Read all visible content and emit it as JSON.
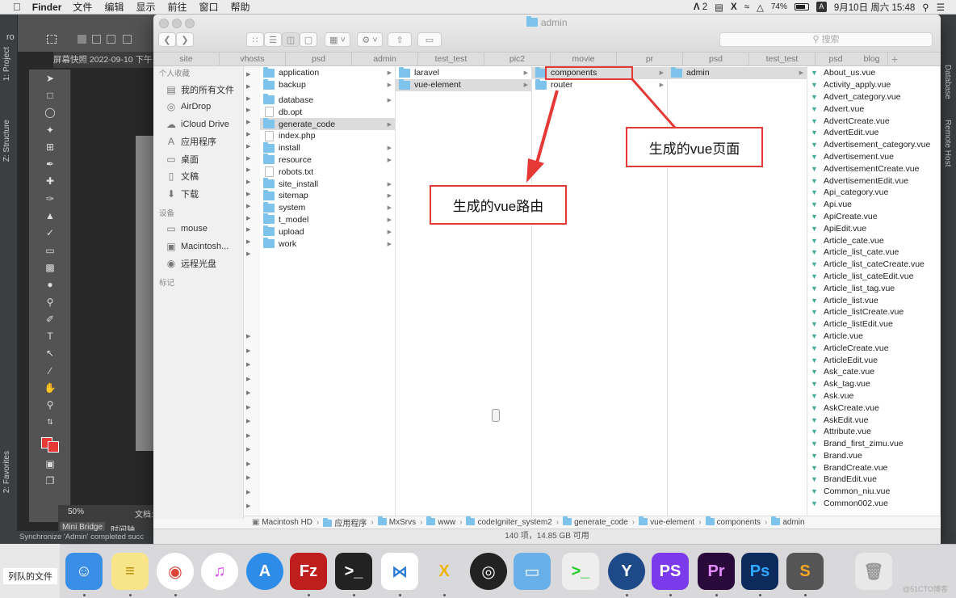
{
  "menubar": {
    "apple": "",
    "app_name": "Finder",
    "menus": [
      "文件",
      "编辑",
      "显示",
      "前往",
      "窗口",
      "帮助"
    ],
    "status": {
      "adobe": "2",
      "battery": "74%",
      "input_method": "A",
      "datetime": "9月10日 周六 15:48"
    }
  },
  "ide": {
    "left_tabs": [
      "1: Project",
      "Z: Structure",
      "2: Favorites"
    ],
    "right_tabs": [
      "Database",
      "Remote Host"
    ],
    "sync_message": "Synchronize 'Admin' completed succ",
    "project_label": "ro"
  },
  "photoshop": {
    "doc_title": "屏幕快照 2022-09-10 下午",
    "zoom": "50%",
    "doc_label": "文档:",
    "bottom_tabs": [
      "Mini Bridge",
      "时间轴"
    ]
  },
  "queued_window": {
    "label": "列队的文件"
  },
  "finder": {
    "window_title": "admin",
    "search_placeholder": "搜索",
    "tabs": [
      "site",
      "vhosts",
      "psd",
      "admin",
      "test_test",
      "pic2",
      "movie",
      "pr",
      "psd",
      "test_test",
      "psd",
      "blog"
    ],
    "sidebar": {
      "favorites_header": "个人收藏",
      "favorites": [
        {
          "label": "我的所有文件",
          "icon": "all-files-icon"
        },
        {
          "label": "AirDrop",
          "icon": "airdrop-icon"
        },
        {
          "label": "iCloud Drive",
          "icon": "cloud-icon"
        },
        {
          "label": "应用程序",
          "icon": "applications-icon"
        },
        {
          "label": "桌面",
          "icon": "desktop-icon"
        },
        {
          "label": "文稿",
          "icon": "documents-icon"
        },
        {
          "label": "下载",
          "icon": "download-icon"
        }
      ],
      "devices_header": "设备",
      "devices": [
        {
          "label": "mouse",
          "icon": "laptop-icon"
        },
        {
          "label": "Macintosh...",
          "icon": "disk-icon"
        },
        {
          "label": "远程光盘",
          "icon": "optical-disc-icon"
        }
      ],
      "tags_header": "标记"
    },
    "columns": [
      {
        "items": [
          {
            "name": "application",
            "type": "folder"
          },
          {
            "name": "backup",
            "type": "folder"
          },
          {
            "name": "database",
            "type": "folder"
          },
          {
            "name": "db.opt",
            "type": "file"
          },
          {
            "name": "generate_code",
            "type": "folder",
            "selected": true
          },
          {
            "name": "index.php",
            "type": "file"
          },
          {
            "name": "install",
            "type": "folder"
          },
          {
            "name": "resource",
            "type": "folder"
          },
          {
            "name": "robots.txt",
            "type": "file"
          },
          {
            "name": "site_install",
            "type": "folder"
          },
          {
            "name": "sitemap",
            "type": "folder"
          },
          {
            "name": "system",
            "type": "folder"
          },
          {
            "name": "t_model",
            "type": "folder"
          },
          {
            "name": "upload",
            "type": "folder"
          },
          {
            "name": "work",
            "type": "folder"
          }
        ]
      },
      {
        "items": [
          {
            "name": "laravel",
            "type": "folder"
          },
          {
            "name": "vue-element",
            "type": "folder",
            "selected": true
          }
        ]
      },
      {
        "items": [
          {
            "name": "components",
            "type": "folder",
            "selected": true
          },
          {
            "name": "router",
            "type": "folder"
          }
        ]
      },
      {
        "items": [
          {
            "name": "admin",
            "type": "folder",
            "selected": true
          }
        ]
      },
      {
        "items": [
          "About_us.vue",
          "Activity_apply.vue",
          "Advert_category.vue",
          "Advert.vue",
          "AdvertCreate.vue",
          "AdvertEdit.vue",
          "Advertisement_category.vue",
          "Advertisement.vue",
          "AdvertisementCreate.vue",
          "AdvertisementEdit.vue",
          "Api_category.vue",
          "Api.vue",
          "ApiCreate.vue",
          "ApiEdit.vue",
          "Article_cate.vue",
          "Article_list_cate.vue",
          "Article_list_cateCreate.vue",
          "Article_list_cateEdit.vue",
          "Article_list_tag.vue",
          "Article_list.vue",
          "Article_listCreate.vue",
          "Article_listEdit.vue",
          "Article.vue",
          "ArticleCreate.vue",
          "ArticleEdit.vue",
          "Ask_cate.vue",
          "Ask_tag.vue",
          "Ask.vue",
          "AskCreate.vue",
          "AskEdit.vue",
          "Attribute.vue",
          "Brand_first_zimu.vue",
          "Brand.vue",
          "BrandCreate.vue",
          "BrandEdit.vue",
          "Common_niu.vue",
          "Common002.vue"
        ]
      }
    ],
    "path": [
      "Macintosh HD",
      "应用程序",
      "MxSrvs",
      "www",
      "codeIgniter_system2",
      "generate_code",
      "vue-element",
      "components",
      "admin"
    ],
    "status": "140 项，14.85 GB 可用"
  },
  "annotations": {
    "router_label": "生成的vue路由",
    "page_label": "生成的vue页面",
    "color": "#e53935"
  },
  "dock": {
    "apps": [
      "Finder",
      "Notes",
      "Chrome",
      "iTunes",
      "App Store",
      "FileZilla",
      "Terminal",
      "VS Code",
      "XAMPP",
      "OBS",
      "Screen Sharing",
      "Script Editor",
      "SourceTree",
      "PhpStorm",
      "Premiere Pro",
      "Photoshop",
      "Sublime Text",
      "Trash"
    ],
    "watermark": "@51CTO博客"
  }
}
